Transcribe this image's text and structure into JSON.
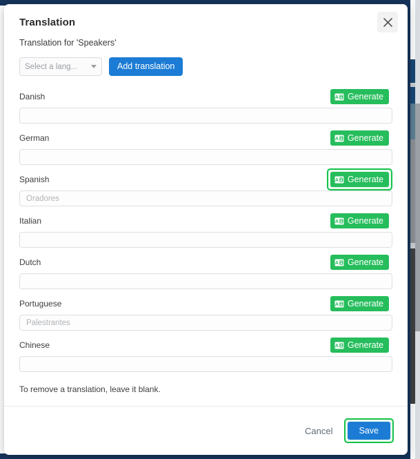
{
  "modal": {
    "title": "Translation",
    "subtitle": "Translation for 'Speakers'",
    "close_icon": "close-icon",
    "note": "To remove a translation, leave it blank."
  },
  "toolbar": {
    "select_value": "Select a lang...",
    "select_caret_icon": "chevron-down-icon",
    "add_translation_label": "Add translation"
  },
  "generate_label": "Generate",
  "generate_icon": "translate-icon",
  "rows": [
    {
      "language": "Danish",
      "value": "",
      "placeholder": "",
      "highlighted": false
    },
    {
      "language": "German",
      "value": "",
      "placeholder": "",
      "highlighted": false
    },
    {
      "language": "Spanish",
      "value": "",
      "placeholder": "Oradores",
      "highlighted": true
    },
    {
      "language": "Italian",
      "value": "",
      "placeholder": "",
      "highlighted": false
    },
    {
      "language": "Dutch",
      "value": "",
      "placeholder": "",
      "highlighted": false
    },
    {
      "language": "Portuguese",
      "value": "",
      "placeholder": "Palestrantes",
      "highlighted": false
    },
    {
      "language": "Chinese",
      "value": "",
      "placeholder": "",
      "highlighted": false
    }
  ],
  "footer": {
    "cancel_label": "Cancel",
    "save_label": "Save",
    "save_highlighted": true
  },
  "colors": {
    "generate_green": "#26bd5c",
    "highlight_green": "#15c24a",
    "primary_blue": "#1c7cd5",
    "backdrop_navy": "#16355c"
  }
}
